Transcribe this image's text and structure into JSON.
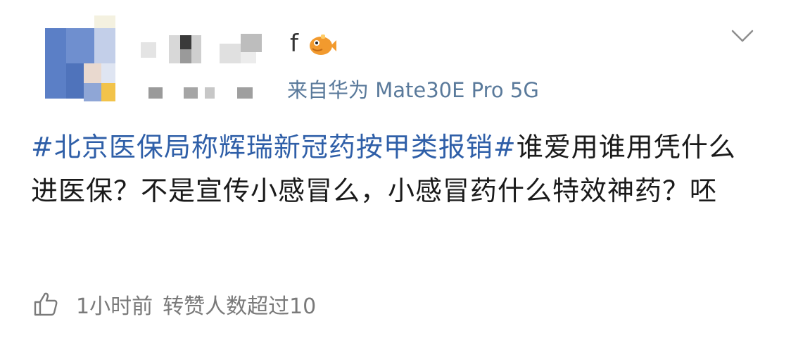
{
  "post": {
    "username_visible": "f",
    "source_suffix": "来自华为 Mate30E Pro 5G",
    "hashtag": "#北京医保局称辉瑞新冠药按甲类报销#",
    "body": "谁爱用谁用凭什么进医保？不是宣传小感冒么，小感冒药什么特效神药？呸",
    "time": "1小时前",
    "repost_info": "转赞人数超过10"
  },
  "icons": {
    "avatar": "blurred-avatar",
    "badge": "fish-icon",
    "more": "chevron-down-icon",
    "like": "thumbs-up-icon"
  },
  "colors": {
    "hashtag": "#2f5fa8",
    "device": "#5a7a9b",
    "meta": "#7a7a7a"
  }
}
